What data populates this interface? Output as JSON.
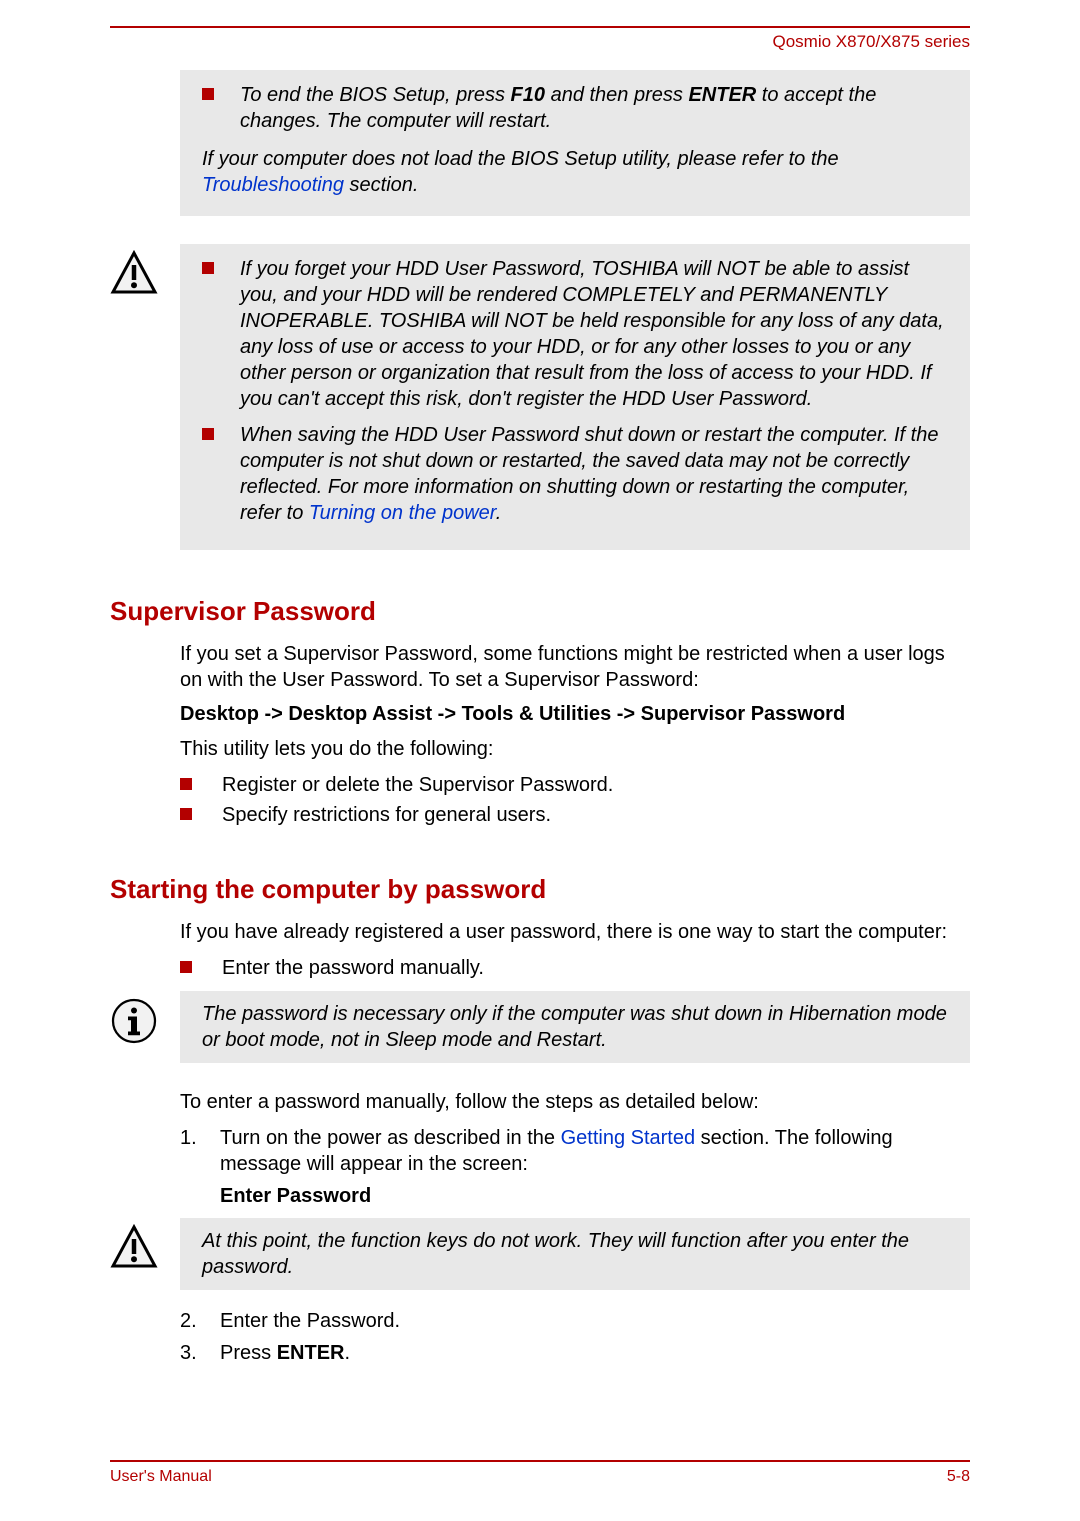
{
  "header": {
    "product": "Qosmio X870/X875 series"
  },
  "topbox": {
    "bullet1_pre": "To end the BIOS Setup, press ",
    "bullet1_b1": "F10",
    "bullet1_mid": " and then press ",
    "bullet1_b2": "ENTER",
    "bullet1_post": " to accept the changes. The computer will restart.",
    "follow_pre": "If your computer does not load the BIOS Setup utility, please refer to the ",
    "follow_link": "Troubleshooting",
    "follow_post": " section."
  },
  "warn": {
    "b1": "If you forget your HDD User Password, TOSHIBA will NOT be able to assist you, and your HDD will be rendered COMPLETELY and PERMANENTLY INOPERABLE. TOSHIBA will NOT be held responsible for any loss of any data, any loss of use or access to your HDD, or for any other losses to you or any other person or organization that result from the loss of access to your HDD. If you can't accept this risk, don't register the HDD User Password.",
    "b2_pre": "When saving the HDD User Password shut down or restart the computer. If the computer is not shut down or restarted, the saved data may not be correctly reflected. For more information on shutting down or restarting the computer, refer to ",
    "b2_link": "Turning on the power",
    "b2_post": "."
  },
  "sup": {
    "title": "Supervisor Password",
    "p1": "If you set a Supervisor Password, some functions might be restricted when a user logs on with the User Password. To set a Supervisor Password:",
    "path": "Desktop -> Desktop Assist -> Tools & Utilities -> Supervisor Password",
    "p2": "This utility lets you do the following:",
    "li1": "Register or delete the Supervisor Password.",
    "li2": "Specify restrictions for general users."
  },
  "start": {
    "title": "Starting the computer by password",
    "p1": "If you have already registered a user password, there is one way to start the computer:",
    "li1": "Enter the password manually.",
    "info": "The password is necessary only if the computer was shut down in Hibernation mode or boot mode, not in Sleep mode and Restart.",
    "p2": "To enter a password manually, follow the steps as detailed below:",
    "step1_pre": "Turn on the power as described in the ",
    "step1_link": "Getting Started",
    "step1_post": " section. The following message will appear in the screen:",
    "enterpw": "Enter Password",
    "warn2": "At this point, the function keys do not work. They will function after you enter the password.",
    "step2": "Enter the Password.",
    "step3_pre": "Press ",
    "step3_b": "ENTER",
    "step3_post": "."
  },
  "footer": {
    "left": "User's Manual",
    "right": "5-8"
  }
}
